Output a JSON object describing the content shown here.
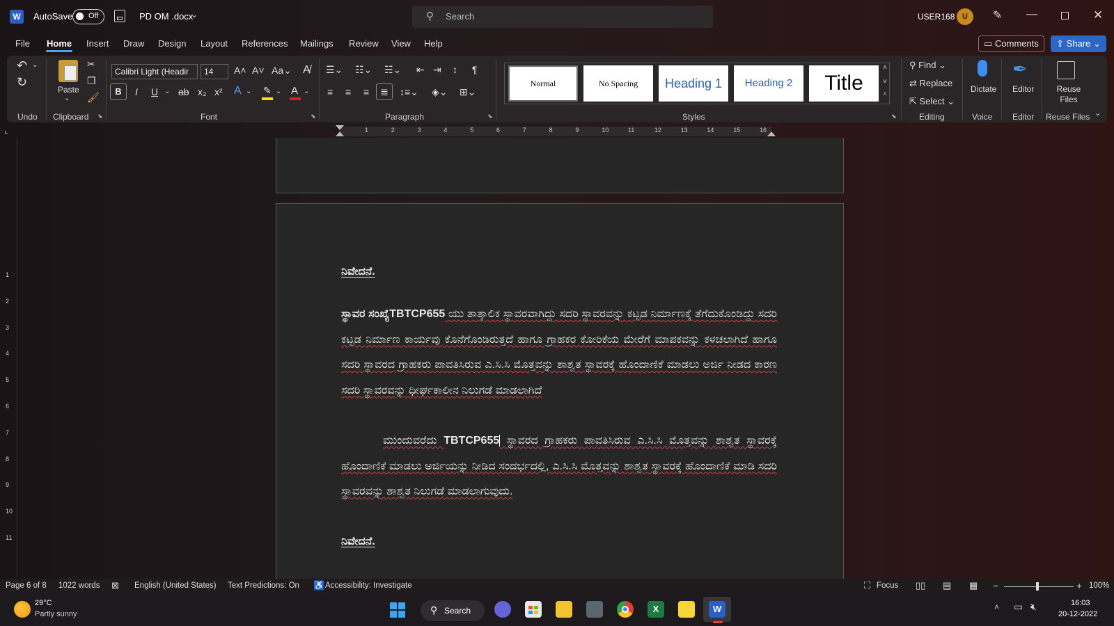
{
  "titlebar": {
    "autosave_label": "AutoSave",
    "autosave_state": "Off",
    "document_name": "PD OM .docx",
    "search_placeholder": "Search",
    "username": "USER168",
    "avatar_initial": "U"
  },
  "menu": {
    "items": [
      "File",
      "Home",
      "Insert",
      "Draw",
      "Design",
      "Layout",
      "References",
      "Mailings",
      "Review",
      "View",
      "Help"
    ],
    "active": "Home",
    "comments_label": "Comments",
    "share_label": "Share"
  },
  "ribbon": {
    "undo_group": "Undo",
    "clipboard_group": "Clipboard",
    "paste_label": "Paste",
    "font_group": "Font",
    "font_name": "Calibri Light (Headir",
    "font_size": "14",
    "paragraph_group": "Paragraph",
    "styles_group": "Styles",
    "styles": [
      "Normal",
      "No Spacing",
      "Heading 1",
      "Heading 2",
      "Title"
    ],
    "editing_group": "Editing",
    "find_label": "Find",
    "replace_label": "Replace",
    "select_label": "Select",
    "voice_group": "Voice",
    "dictate_label": "Dictate",
    "editor_group": "Editor",
    "editor_label": "Editor",
    "reuse_group": "Reuse Files",
    "reuse_label": "Reuse Files"
  },
  "ruler": {
    "numbers": [
      "1",
      "2",
      "3",
      "4",
      "5",
      "6",
      "7",
      "8",
      "9",
      "10",
      "11",
      "12",
      "13",
      "14",
      "15",
      "16"
    ],
    "vertical_numbers": [
      "1",
      "2",
      "3",
      "4",
      "5",
      "6",
      "7",
      "8",
      "9",
      "10",
      "11"
    ]
  },
  "document": {
    "heading1": "ನಿವೇದನೆ.",
    "para1_bold": "ಸ್ಥಾವರ ಸಂಖ್ಯೆTBTCP655",
    "para1_rest": " ಯು ತಾತ್ಕಾಲಿಕ ಸ್ಥಾವರವಾಗಿದ್ದು ಸದರಿ ಸ್ಥಾವರವನ್ನು ಕಟ್ಟಡ ನಿರ್ಮಾಣಕ್ಕೆ ತೆಗೆದುಕೊಂಡಿದ್ದು ಸದರಿ ಕಟ್ಟಡ ನಿರ್ಮಾಣ ಕಾರ್ಯವು ಕೊನೆಗೊಂಡಿರುತ್ತದೆ ಹಾಗೂ ಗ್ರಾಹಕರ ಕೋರಿಕೆಯ ಮೇರೆಗೆ ಮಾಪಕವನ್ನು ಕಳಚಲಾಗಿದೆ ಹಾಗೂ ಸದರಿ ಸ್ಥಾವರದ ಗ್ರಾಹಕರು ಪಾವತಿಸಿರುವ ಎ.ಸಿ.ಸಿ ಮೊತ್ತವನ್ನು ಶಾಶ್ವತ ಸ್ಥಾವರಕ್ಕೆ ಹೊಂದಾಣಿಕೆ ಮಾಡಲು ಅರ್ಜಿ ನೀಡದ ಕಾರಣ ಸದರಿ ಸ್ಥಾವರವನ್ನು ಧೀರ್ಘಕಾಲೀನ ನಿಲುಗಡೆ ಮಾಡಲಾಗಿದೆ",
    "para2_start": "ಮುಂದುವರೆದು ",
    "para2_bold": "TBTCP655",
    "para2_rest": " ಸ್ಥಾವರದ ಗ್ರಾಹಕರು ಪಾವತಿಸಿರುವ ಎ.ಸಿ.ಸಿ ಮೊತ್ತವನ್ನು ಶಾಶ್ವತ ಸ್ಥಾವರಕ್ಕೆ ಹೊಂದಾಣಿಕೆ ಮಾಡಲು ಅರ್ಜಿಯನ್ನು ನೀಡಿದ ಸಂದರ್ಭದಲ್ಲಿ, ಎ.ಸಿ.ಸಿ ಮೊತ್ತವನ್ನು ಶಾಶ್ವತ ಸ್ಥಾವರಕ್ಕೆ ಹೊಂದಾಣಿಕೆ ಮಾಡಿ ಸದರಿ ಸ್ಥಾವರವನ್ನು ಶಾಶ್ವತ ನಿಲುಗಡೆ ಮಾಡಲಾಗುವುದು.",
    "heading2": "ನಿವೇದನೆ."
  },
  "statusbar": {
    "page": "Page 6 of 8",
    "words": "1022 words",
    "language": "English (United States)",
    "predictions": "Text Predictions: On",
    "accessibility": "Accessibility: Investigate",
    "focus": "Focus",
    "zoom": "100%"
  },
  "taskbar": {
    "weather_temp": "29°C",
    "weather_desc": "Partly sunny",
    "search_label": "Search",
    "time": "16:03",
    "date": "20-12-2022"
  },
  "colors": {
    "accent": "#2d67c6",
    "word_blue": "#2b5fc7",
    "excel_green": "#1e7a43"
  }
}
